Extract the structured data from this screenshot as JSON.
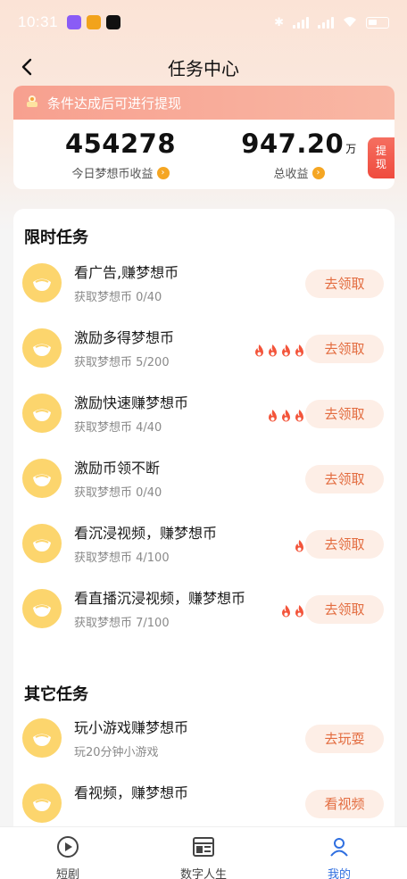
{
  "status_bar": {
    "time": "10:31"
  },
  "header": {
    "title": "任务中心"
  },
  "banner": {
    "text": "条件达成后可进行提现"
  },
  "stats": {
    "today": {
      "value": "454278",
      "label": "今日梦想币收益"
    },
    "total": {
      "value": "947.20",
      "unit": "万",
      "label": "总收益"
    },
    "withdraw_label": "提现"
  },
  "limited_tasks": {
    "title": "限时任务",
    "items": [
      {
        "title": "看广告,赚梦想币",
        "sub": "获取梦想币  0/40",
        "fires": 0,
        "button": "去领取"
      },
      {
        "title": "激励多得梦想币",
        "sub": "获取梦想币  5/200",
        "fires": 4,
        "button": "去领取"
      },
      {
        "title": "激励快速赚梦想币",
        "sub": "获取梦想币  4/40",
        "fires": 3,
        "button": "去领取"
      },
      {
        "title": "激励币领不断",
        "sub": "获取梦想币  0/40",
        "fires": 0,
        "button": "去领取"
      },
      {
        "title": "看沉浸视频，赚梦想币",
        "sub": "获取梦想币  4/100",
        "fires": 1,
        "button": "去领取"
      },
      {
        "title": "看直播沉浸视频，赚梦想币",
        "sub": "获取梦想币  7/100",
        "fires": 2,
        "button": "去领取"
      }
    ]
  },
  "other_tasks": {
    "title": "其它任务",
    "items": [
      {
        "title": "玩小游戏赚梦想币",
        "sub": "玩20分钟小游戏",
        "button": "去玩耍"
      },
      {
        "title": "看视频，赚梦想币",
        "sub": "",
        "button": "看视频"
      }
    ]
  },
  "bottom_nav": {
    "items": [
      {
        "label": "短剧",
        "icon": "play-circle-icon"
      },
      {
        "label": "数字人生",
        "icon": "board-icon"
      },
      {
        "label": "我的",
        "icon": "user-icon"
      }
    ],
    "active_index": 2
  },
  "colors": {
    "accent": "#e36c3f",
    "banner": "#f7a08f",
    "coin": "#fcd56d",
    "active_tab": "#2f6fe0"
  }
}
